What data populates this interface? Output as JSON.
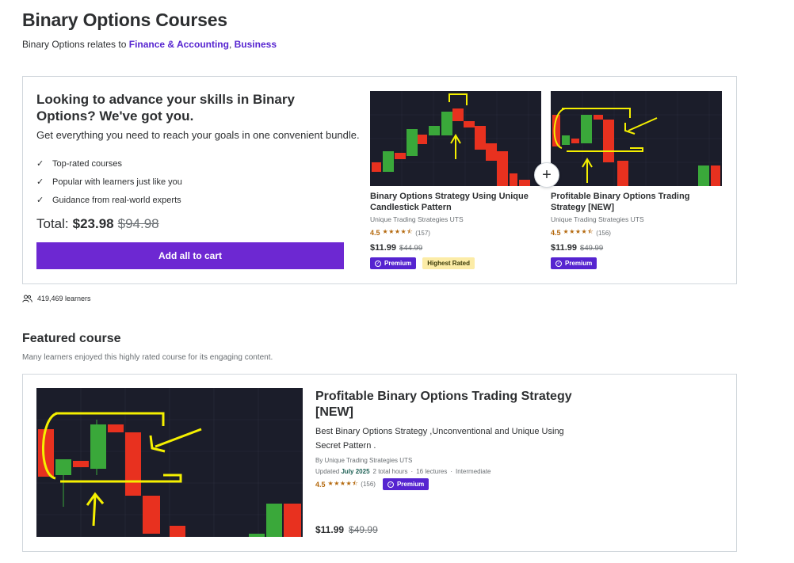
{
  "page": {
    "title": "Binary Options Courses",
    "relates_prefix": "Binary Options relates to ",
    "relates_links": [
      "Finance & Accounting",
      "Business"
    ]
  },
  "bundle": {
    "heading": "Looking to advance your skills in Binary Options? We've got you.",
    "subheading": "Get everything you need to reach your goals in one convenient bundle.",
    "checks": [
      "Top-rated courses",
      "Popular with learners just like you",
      "Guidance from real-world experts"
    ],
    "total_label": "Total:",
    "total_price": "$23.98",
    "total_original": "$94.98",
    "cart_button": "Add all to cart",
    "plus_symbol": "+",
    "courses": [
      {
        "title": "Binary Options Strategy Using Unique Candlestick Pattern",
        "author": "Unique Trading Strategies UTS",
        "rating": "4.5",
        "stars": "★★★★⯪",
        "reviews": "(157)",
        "price": "$11.99",
        "original_price": "$44.99",
        "badges": [
          "Premium",
          "Highest Rated"
        ]
      },
      {
        "title": "Profitable Binary Options Trading Strategy [NEW]",
        "author": "Unique Trading Strategies UTS",
        "rating": "4.5",
        "stars": "★★★★⯪",
        "reviews": "(156)",
        "price": "$11.99",
        "original_price": "$49.99",
        "badges": [
          "Premium"
        ]
      }
    ]
  },
  "learners": {
    "count": "419,469 learners"
  },
  "featured": {
    "heading": "Featured course",
    "subheading": "Many learners enjoyed this highly rated course for its engaging content.",
    "course": {
      "title": "Profitable Binary Options Trading Strategy [NEW]",
      "description": "Best Binary Options Strategy ,Unconventional and Unique Using Secret Pattern .",
      "author": "By Unique Trading Strategies UTS",
      "updated_label": "Updated",
      "updated_date": "July 2025",
      "hours": "2 total hours",
      "lectures": "16 lectures",
      "level": "Intermediate",
      "dot": "·",
      "rating": "4.5",
      "stars": "★★★★⯪",
      "reviews": "(156)",
      "badge": "Premium",
      "price": "$11.99",
      "original_price": "$49.99"
    }
  },
  "colors": {
    "brand_purple": "#6d28d2",
    "link_purple": "#5624d0",
    "star_orange": "#b4690e",
    "candle_green": "#3aa83a",
    "candle_red": "#e8311f",
    "chart_bg": "#1b1d2a",
    "annotation_yellow": "#f5f000",
    "highest_rated_bg": "#fceca7"
  },
  "icons": [
    "check-icon",
    "plus-icon",
    "users-icon",
    "premium-icon",
    "star-icon"
  ]
}
